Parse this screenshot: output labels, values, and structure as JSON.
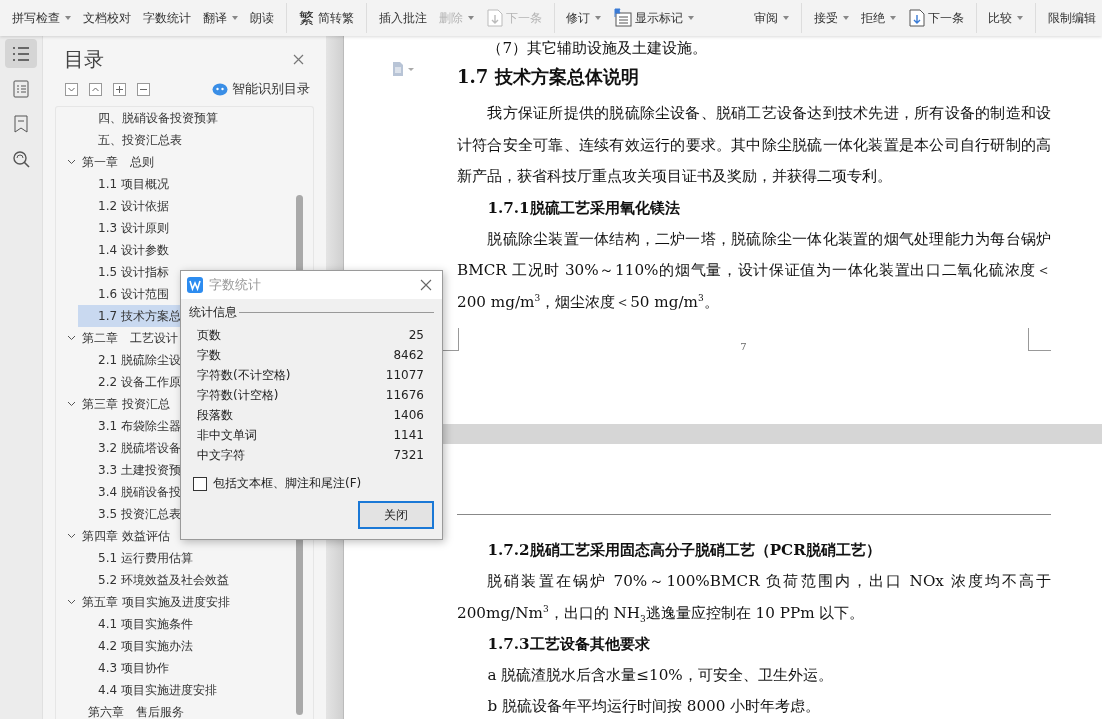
{
  "toolbar": {
    "items": [
      {
        "kind": "button",
        "label": "拼写检查",
        "dropdown": true,
        "disabled": false
      },
      {
        "kind": "button",
        "label": "文档校对",
        "dropdown": false,
        "disabled": false
      },
      {
        "kind": "button",
        "label": "字数统计",
        "dropdown": false,
        "disabled": false
      },
      {
        "kind": "button",
        "label": "翻译",
        "dropdown": true,
        "disabled": false
      },
      {
        "kind": "button",
        "label": "朗读",
        "dropdown": false,
        "disabled": false
      },
      {
        "kind": "separator"
      },
      {
        "kind": "button",
        "label": "简转繁",
        "icon_text": "繁",
        "dropdown": false,
        "disabled": false
      },
      {
        "kind": "separator"
      },
      {
        "kind": "button",
        "label": "插入批注",
        "dropdown": false,
        "disabled": false
      },
      {
        "kind": "button",
        "label": "删除",
        "dropdown": true,
        "disabled": true
      },
      {
        "kind": "next_button",
        "label": "下一条",
        "dropdown": false,
        "disabled": true
      },
      {
        "kind": "separator"
      },
      {
        "kind": "button",
        "label": "修订",
        "dropdown": true,
        "disabled": false
      },
      {
        "kind": "markup_button",
        "label": "显示标记",
        "dropdown": true,
        "disabled": false
      },
      {
        "kind": "spacer"
      },
      {
        "kind": "button",
        "label": "审阅",
        "dropdown": true,
        "disabled": false
      },
      {
        "kind": "separator"
      },
      {
        "kind": "button",
        "label": "接受",
        "dropdown": true,
        "disabled": false
      },
      {
        "kind": "button",
        "label": "拒绝",
        "dropdown": true,
        "disabled": false
      },
      {
        "kind": "next_button",
        "label": "下一条",
        "dropdown": false,
        "disabled": false
      },
      {
        "kind": "separator"
      },
      {
        "kind": "button",
        "label": "比较",
        "dropdown": true,
        "disabled": false
      },
      {
        "kind": "separator"
      },
      {
        "kind": "button",
        "label": "限制编辑",
        "dropdown": false,
        "disabled": false
      }
    ]
  },
  "rail": [
    {
      "selected": true
    },
    {
      "selected": false
    },
    {
      "selected": false
    },
    {
      "selected": false
    }
  ],
  "toc": {
    "title": "目录",
    "smart_button": "智能识别目录",
    "items": [
      {
        "children": [
          {
            "label": "四、脱硝设备投资预算",
            "selected": false
          },
          {
            "label": "五、投资汇总表",
            "selected": false
          }
        ]
      },
      {
        "label": "第一章　总则",
        "expanded": true,
        "children": [
          {
            "label": "1.1 项目概况",
            "selected": false
          },
          {
            "label": "1.2  设计依据",
            "selected": false
          },
          {
            "label": "1.3  设计原则",
            "selected": false
          },
          {
            "label": "1.4  设计参数",
            "selected": false
          },
          {
            "label": "1.5  设计指标",
            "selected": false
          },
          {
            "label": "1.6  设计范围",
            "selected": false
          },
          {
            "label": "1.7  技术方案总",
            "selected": true
          }
        ]
      },
      {
        "label": "第二章　工艺设计",
        "expanded": true,
        "children": [
          {
            "label": "2.1  脱硫除尘设",
            "selected": false
          },
          {
            "label": "2.2 设备工作原",
            "selected": false
          }
        ]
      },
      {
        "label": "第三章 投资汇总",
        "expanded": true,
        "children": [
          {
            "label": "3.1 布袋除尘器",
            "selected": false
          },
          {
            "label": "3.2 脱硫塔设备",
            "selected": false
          },
          {
            "label": "3.3 土建投资预",
            "selected": false
          },
          {
            "label": "3.4 脱硝设备投",
            "selected": false
          },
          {
            "label": "3.5 投资汇总表",
            "selected": false
          }
        ]
      },
      {
        "label": "第四章 效益评估",
        "expanded": true,
        "children": [
          {
            "label": "5.1 运行费用估算",
            "selected": false
          },
          {
            "label": "5.2 环境效益及社会效益",
            "selected": false
          }
        ]
      },
      {
        "label": "第五章 项目实施及进度安排",
        "expanded": true,
        "children": [
          {
            "label": "4.1 项目实施条件",
            "selected": false
          },
          {
            "label": "4.2 项目实施办法",
            "selected": false
          },
          {
            "label": "4.3 项目协作",
            "selected": false
          },
          {
            "label": "4.4 项目实施进度安排",
            "selected": false
          }
        ]
      },
      {
        "label": "第六章　售后服务",
        "selected": false
      }
    ]
  },
  "dialog": {
    "title": "字数统计",
    "group": "统计信息",
    "stats": [
      {
        "label": "页数",
        "value": "25"
      },
      {
        "label": "字数",
        "value": "8462"
      },
      {
        "label": "字符数(不计空格)",
        "value": "11077"
      },
      {
        "label": "字符数(计空格)",
        "value": "11676"
      },
      {
        "label": "段落数",
        "value": "1406"
      },
      {
        "label": "非中文单词",
        "value": "1141"
      },
      {
        "label": "中文字符",
        "value": "7321"
      }
    ],
    "checkbox": {
      "label": "包括文本框、脚注和尾注(F)",
      "checked": false
    },
    "button": "关闭"
  },
  "document": {
    "pages": [
      {
        "page_number": "7",
        "blocks": [
          {
            "kind": "p",
            "text": "（7）其它辅助设施及土建设施。"
          },
          {
            "kind": "h2",
            "text": "1.7 技术方案总体说明"
          },
          {
            "kind": "p",
            "text": "我方保证所提供的脱硫除尘设备、脱硝工艺设备达到技术先进，所有设备的制造和设计符合安全可靠、连续有效运行的要求。其中除尘脱硫一体化装置是本公司自行研制的高新产品，获省科技厅重点攻关项目证书及奖励，并获得二项专利。"
          },
          {
            "kind": "h3",
            "text": "1.7.1脱硫工艺采用氧化镁法"
          },
          {
            "kind": "p",
            "text": " 脱硫除尘装置一体结构，二炉一塔，脱硫除尘一体化装置的烟气处理能力为每台锅炉 BMCR 工况时 30%～110%的烟气量，设计保证值为一体化装置出口二氧化硫浓度＜200 mg/m$^{3}$，烟尘浓度＜50 mg/m$^{3}$。"
          }
        ]
      },
      {
        "blocks": [
          {
            "kind": "h3",
            "text": "1.7.2脱硝工艺采用固态高分子脱硝工艺（PCR脱硝工艺）"
          },
          {
            "kind": "p",
            "text": "脱硝装置在锅炉 70%～100%BMCR 负荷范围内，出口 NOx 浓度均不高于 200mg/Nm$^{3}$，出口的 NH$_{3}$逃逸量应控制在 10 PPm 以下。"
          },
          {
            "kind": "h3",
            "text": "1.7.3工艺设备其他要求"
          },
          {
            "kind": "item",
            "text": "a 脱硫渣脱水后含水量≤10%，可安全、卫生外运。"
          },
          {
            "kind": "item",
            "text": "b 脱硫设备年平均运行时间按 8000 小时年考虑。"
          }
        ]
      }
    ]
  }
}
